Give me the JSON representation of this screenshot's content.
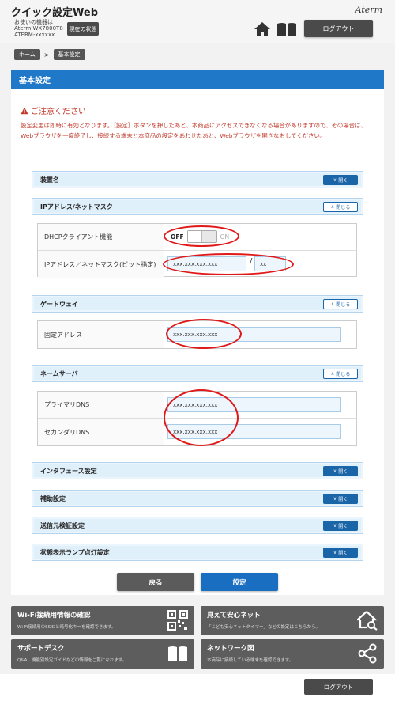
{
  "header": {
    "app_title": "クイック設定Web",
    "device_label": "お使いの機器は",
    "device_model": "Aterm WX7800T8",
    "device_serial": "ATERM-xxxxxx",
    "status_button": "現在の状態",
    "brand": "Aterm",
    "logout": "ログアウト",
    "icons": [
      "home-icon",
      "manual-book-icon"
    ]
  },
  "breadcrumb": {
    "home": "ホーム",
    "separator": ">",
    "current": "基本設定"
  },
  "page_title": "基本設定",
  "notice": {
    "title": "ご注意ください",
    "body": "設定変更は即時に有効となります。［設定］ボタンを押したあと、本商品にアクセスできなくなる場合がありますので、その場合は、Webブラウザを一度終了し、接続する端末と本商品の設定をあわせたあと、Webブラウザを開きなおしてください。"
  },
  "labels": {
    "open": "開く",
    "close": "閉じる"
  },
  "sections": {
    "device_name": {
      "title": "装置名"
    },
    "ip": {
      "title": "IPアドレス/ネットマスク",
      "dhcp_label": "DHCPクライアント機能",
      "dhcp_off": "OFF",
      "dhcp_on": "ON",
      "ip_label": "IPアドレス／ネットマスク(ビット指定)",
      "ip_value": "xxx.xxx.xxx.xxx",
      "slash": "/",
      "mask_value": "xx"
    },
    "gateway": {
      "title": "ゲートウェイ",
      "fixed_label": "固定アドレス",
      "fixed_value": "xxx.xxx.xxx.xxx"
    },
    "dns": {
      "title": "ネームサーバ",
      "primary_label": "プライマリDNS",
      "primary_value": "xxx.xxx.xxx.xxx",
      "secondary_label": "セカンダリDNS",
      "secondary_value": "xxx.xxx.xxx.xxx"
    },
    "interface": {
      "title": "インタフェース設定"
    },
    "auxiliary": {
      "title": "補助設定"
    },
    "source_check": {
      "title": "送信元検証設定"
    },
    "status_lamp": {
      "title": "状態表示ランプ点灯設定"
    }
  },
  "actions": {
    "back": "戻る",
    "apply": "設定"
  },
  "cards": {
    "wifi": {
      "title": "Wi-Fi接続用情報の確認",
      "desc": "Wi-Fi接続用のSSIDと暗号化キーを確認できます。",
      "icon": "qr-code-icon"
    },
    "safety": {
      "title": "見えて安心ネット",
      "desc": "「こども安心ネットタイマー」などの設定はこちらから。",
      "icon": "house-search-icon"
    },
    "support": {
      "title": "サポートデスク",
      "desc": "Q&A、機能別設定ガイドなどの情報をご覧になれます。",
      "icon": "open-book-icon"
    },
    "network": {
      "title": "ネットワーク図",
      "desc": "本商品に接続している端末を確認できます。",
      "icon": "network-share-icon"
    }
  },
  "colors": {
    "primary": "#1f78c8",
    "dark_button": "#4a4a4a",
    "annotation": "#e01818",
    "warning": "#c0392b"
  }
}
